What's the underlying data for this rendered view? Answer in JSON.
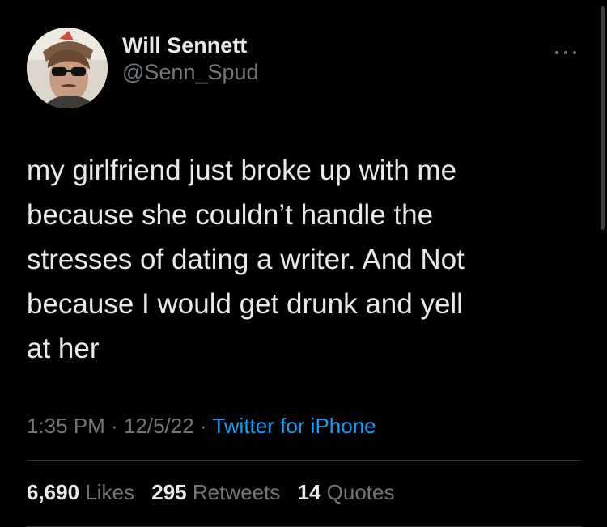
{
  "author": {
    "display_name": "Will Sennett",
    "handle": "@Senn_Spud"
  },
  "tweet": {
    "text": "my girlfriend just broke up with me\nbecause she couldn’t handle the\nstresses of dating a writer. And Not\nbecause I would get drunk and yell\nat her",
    "time": "1:35 PM",
    "separator": " · ",
    "date": "12/5/22",
    "source": "Twitter for iPhone"
  },
  "stats": {
    "likes_count": "6,690",
    "likes_label": "Likes",
    "retweets_count": "295",
    "retweets_label": "Retweets",
    "quotes_count": "14",
    "quotes_label": "Quotes"
  },
  "icons": {
    "more": "more-horizontal-icon"
  },
  "colors": {
    "background": "#000000",
    "primary_text": "#e7e9ea",
    "secondary_text": "#71767b",
    "link": "#1d9bf0",
    "divider": "#2f3336"
  }
}
